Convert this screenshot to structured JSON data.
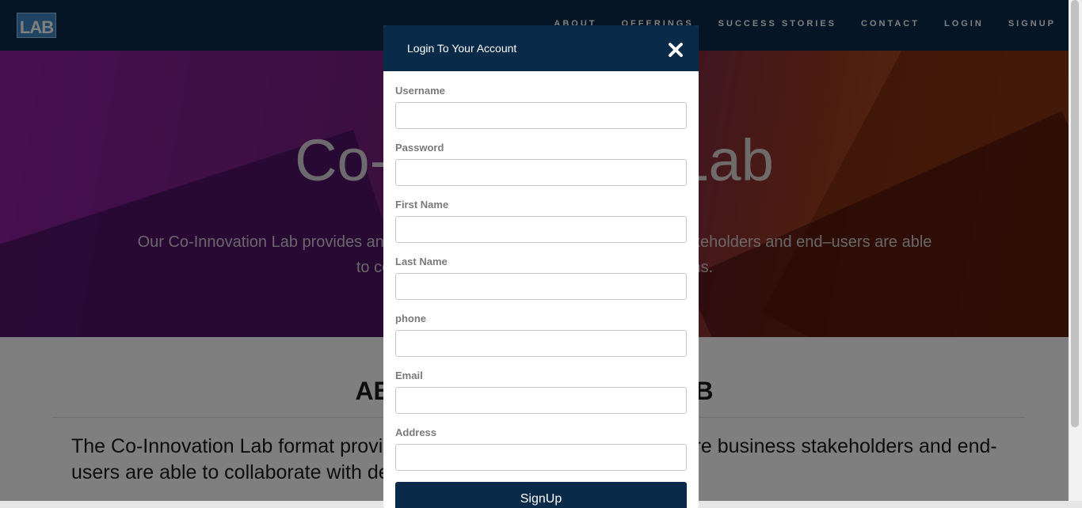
{
  "nav": {
    "logo_text": "LAB",
    "logo_small": "",
    "links": [
      "ABOUT",
      "OFFERINGS",
      "SUCCESS STORIES",
      "CONTACT",
      "LOGIN",
      "SIGNUP"
    ]
  },
  "hero": {
    "title": "Co-Innovation Lab",
    "subtitle": "Our Co-Innovation Lab provides an interactive environment where business stakeholders and end–users are able to collaborate with design and development teams."
  },
  "about": {
    "title": "ABOUT CO-INNOVATION LAB",
    "text": "The Co-Innovation Lab format provides an interactive environment where business stakeholders and end-users are able to collaborate with design team"
  },
  "modal": {
    "title": "Login To Your Account",
    "close_icon": "close-x-icon",
    "fields": [
      {
        "label": "Username",
        "value": ""
      },
      {
        "label": "Password",
        "value": ""
      },
      {
        "label": "First Name",
        "value": ""
      },
      {
        "label": "Last Name",
        "value": ""
      },
      {
        "label": "phone",
        "value": ""
      },
      {
        "label": "Email",
        "value": ""
      },
      {
        "label": "Address",
        "value": ""
      }
    ],
    "submit_label": "SignUp"
  },
  "colors": {
    "navy": "#0a2a4a",
    "overlay": "rgba(0,0,0,0.5)"
  }
}
